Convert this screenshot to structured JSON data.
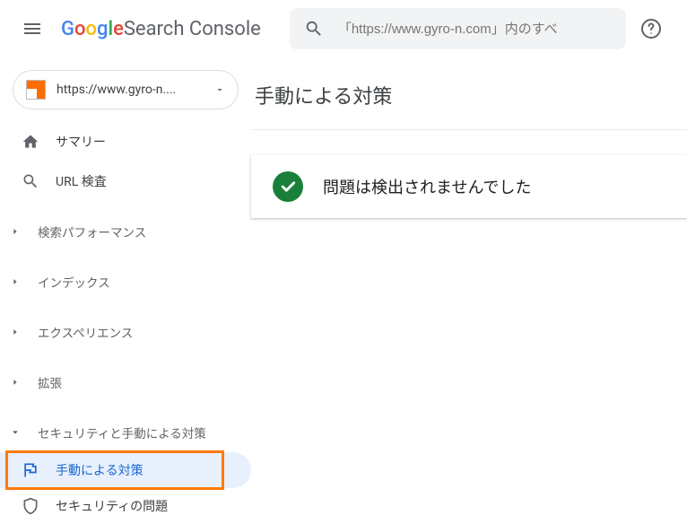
{
  "header": {
    "product_name": " Search Console",
    "search_placeholder": "「https://www.gyro-n.com」内のすべ"
  },
  "sidebar": {
    "property_label": "https://www.gyro-n....",
    "items": {
      "summary": "サマリー",
      "url_inspect": "URL 検査"
    },
    "sections": {
      "search_perf": "検索パフォーマンス",
      "index": "インデックス",
      "experience": "エクスペリエンス",
      "enhancements": "拡張",
      "security_manual": "セキュリティと手動による対策"
    },
    "manual_action": "手動による対策",
    "security_issues": "セキュリティの問題"
  },
  "main": {
    "title": "手動による対策",
    "status_message": "問題は検出されませんでした"
  }
}
